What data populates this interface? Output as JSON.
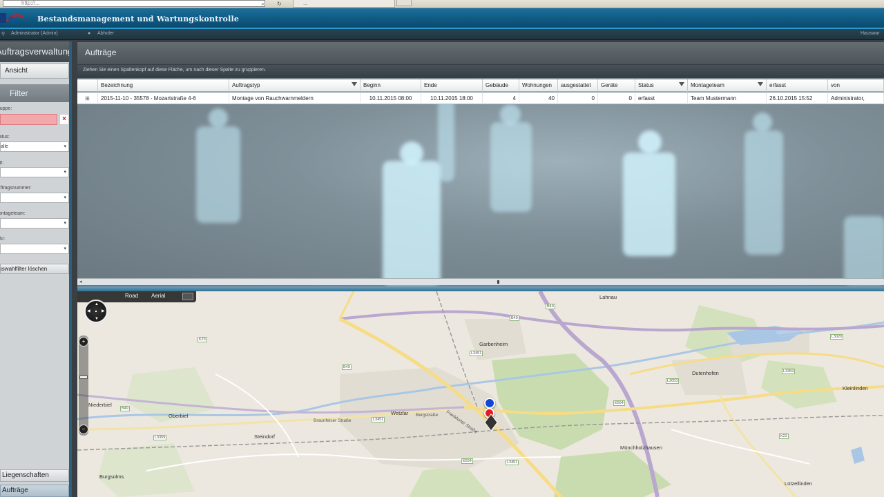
{
  "browser": {
    "address": "http://...",
    "tab2": "...",
    "address_icon": "search-icon",
    "refresh_icon": "refresh-icon"
  },
  "app": {
    "title": "Bestandsmanagement und Wartungskontrolle"
  },
  "user_bar": {
    "user": "Administrator (Admin)",
    "area": "Abholer",
    "right": "Hauswar"
  },
  "sidebar": {
    "header": "Auftragsverwaltung",
    "ansicht": "Ansicht",
    "filter_title": "Filter",
    "filters": [
      {
        "label": "Gruppe:"
      },
      {
        "label": "Status:",
        "value": "alle"
      },
      {
        "label": "Typ:",
        "value": ""
      },
      {
        "label": "Auftragsnummer:",
        "value": ""
      },
      {
        "label": "Montageteam:",
        "value": ""
      },
      {
        "label": "Jahr:",
        "value": ""
      }
    ],
    "clear_filter": "Auswahlfilter löschen",
    "nav_liegenschaften": "Liegenschaften",
    "nav_auftraege": "Aufträge"
  },
  "main": {
    "title": "Aufträge",
    "group_hint": "Ziehen Sie einen Spaltenkopf auf diese Fläche, um nach dieser Spalte zu gruppieren.",
    "columns": [
      "Bezeichnung",
      "Auftragstyp",
      "Beginn",
      "Ende",
      "Gebäude",
      "Wohnungen",
      "ausgestattet",
      "Geräte",
      "Status",
      "Montageteam",
      "erfasst",
      "von"
    ],
    "rows": [
      {
        "bezeichnung": "2015-11-10 - 35578 - Mozartstraße 4-6",
        "auftragstyp": "Montage von Rauchwarnmeldern",
        "beginn": "10.11.2015 08:00",
        "ende": "10.11.2015 18:00",
        "gebaeude": "4",
        "wohnungen": "40",
        "ausgestattet": "0",
        "geraete": "0",
        "status": "erfasst",
        "montageteam": "Team Mustermann",
        "erfasst": "26.10.2015 15:52",
        "von": "Administrator,"
      }
    ]
  },
  "map": {
    "toolbar": {
      "road": "Road",
      "aerial": "Aerial"
    },
    "places": [
      "Lahnau",
      "Garbenheim",
      "Dutenhofen",
      "Kleinlinden",
      "Niederbiel",
      "Oberbiel",
      "Steindorf",
      "Wetzlar",
      "Münchholzhausen",
      "Burgsolms",
      "Lützellinden"
    ],
    "streets": [
      "Braunfelser Straße",
      "Bergstraße",
      "Frankfurter Straße"
    ],
    "roads": [
      "B49",
      "B49",
      "L3451",
      "B49",
      "L3020",
      "L3053",
      "L3451",
      "B49",
      "L3451",
      "E554",
      "K23",
      "K23",
      "L3359",
      "E554",
      "L3359"
    ],
    "pin_colors": {
      "blue": "#1446d6",
      "red": "#e01c24"
    }
  },
  "colors": {
    "header": "#0f5880",
    "accent": "#2a9ad0",
    "error_field": "#f3a8ac"
  }
}
